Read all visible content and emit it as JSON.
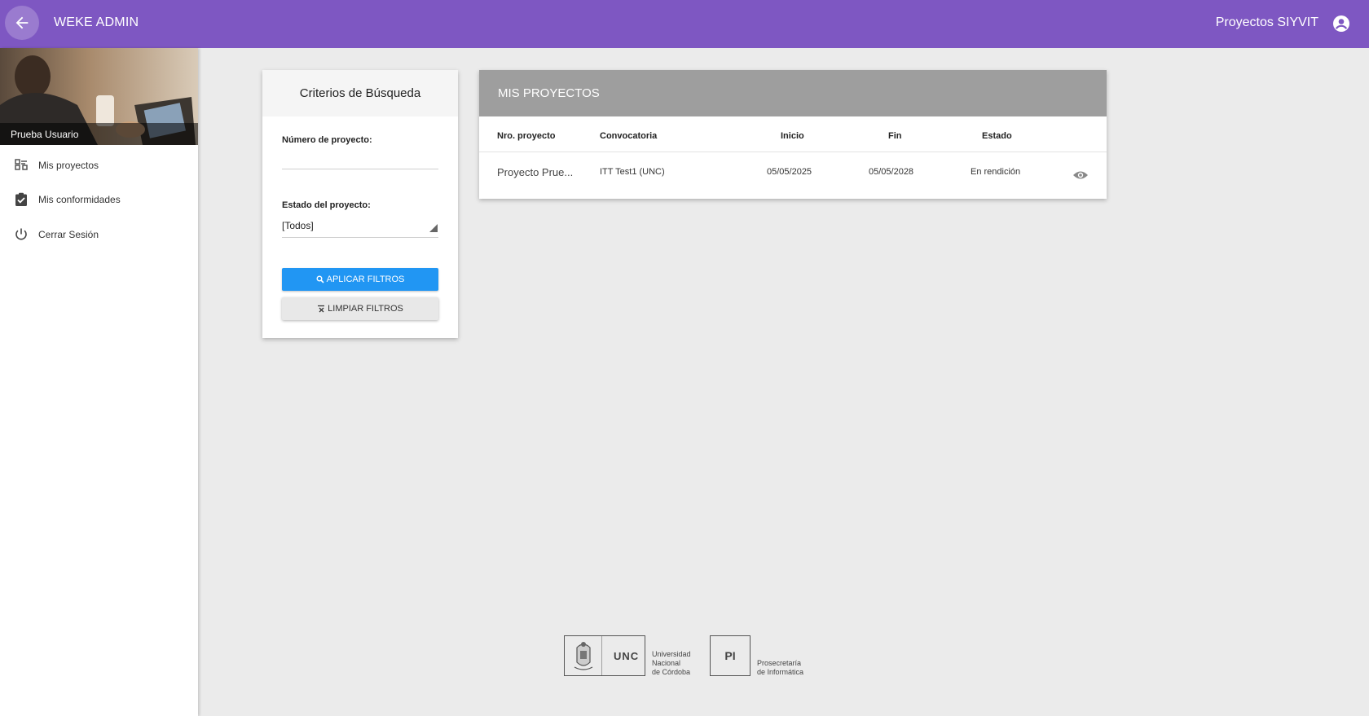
{
  "topbar": {
    "title": "WEKE ADMIN",
    "app_name": "Proyectos SIYVIT"
  },
  "sidebar": {
    "user_name": "Prueba Usuario",
    "items": [
      {
        "label": "Mis proyectos",
        "icon": "projects-grid-icon"
      },
      {
        "label": "Mis conformidades",
        "icon": "clipboard-check-icon"
      },
      {
        "label": "Cerrar Sesión",
        "icon": "power-icon"
      }
    ]
  },
  "search": {
    "title": "Criterios de Búsqueda",
    "project_number_label": "Número de proyecto:",
    "project_number_value": "",
    "project_state_label": "Estado del proyecto:",
    "project_state_value": "[Todos]",
    "apply_label": "APLICAR FILTROS",
    "clear_label": "LIMPIAR FILTROS"
  },
  "projects": {
    "title": "MIS PROYECTOS",
    "columns": [
      "Nro. proyecto",
      "Convocatoria",
      "Inicio",
      "Fin",
      "Estado"
    ],
    "rows": [
      {
        "nro": "Proyecto Prue...",
        "convocatoria": "ITT Test1 (UNC)",
        "inicio": "05/05/2025",
        "fin": "05/05/2028",
        "estado": "En rendición"
      }
    ]
  },
  "footer": {
    "unc_abbr": "UNC",
    "unc_line1": "Universidad",
    "unc_line2": "Nacional",
    "unc_line3": "de Córdoba",
    "pi_abbr": "PI",
    "pi_line1": "Prosecretaría",
    "pi_line2": "de Informática"
  },
  "colors": {
    "topbar": "#7e57c2",
    "primary_button": "#2196f3",
    "projects_header": "#9e9e9e",
    "background": "#ebebeb"
  }
}
